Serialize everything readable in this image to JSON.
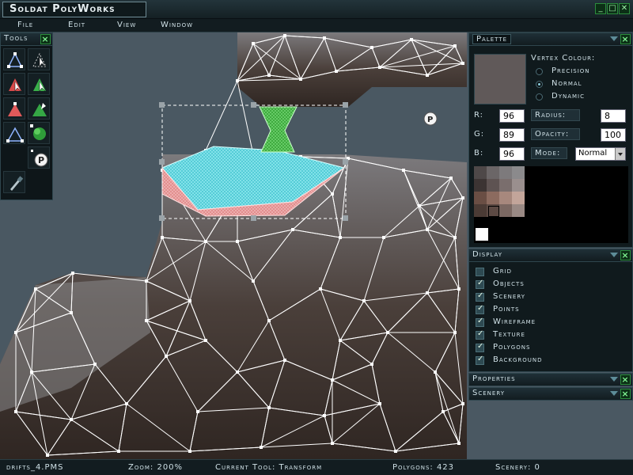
{
  "app": {
    "title": "Soldat PolyWorks"
  },
  "menu": {
    "file": "File",
    "edit": "Edit",
    "view": "View",
    "window": "Window"
  },
  "tools": {
    "title": "Tools"
  },
  "palette": {
    "title": "Palette",
    "vertex_colour_label": "Vertex Colour:",
    "options": [
      "Precision",
      "Normal",
      "Dynamic"
    ],
    "selected_option": "Normal",
    "r_label": "R:",
    "r_value": "96",
    "g_label": "G:",
    "g_value": "89",
    "b_label": "B:",
    "b_value": "96",
    "radius_label": "Radius:",
    "radius_value": "8",
    "opacity_label": "Opacity:",
    "opacity_value": "100",
    "mode_label": "Mode:",
    "mode_value": "Normal",
    "swatch_color": "#605959"
  },
  "display": {
    "title": "Display",
    "items": [
      {
        "label": "Grid",
        "checked": false
      },
      {
        "label": "Objects",
        "checked": true
      },
      {
        "label": "Scenery",
        "checked": true
      },
      {
        "label": "Points",
        "checked": true
      },
      {
        "label": "Wireframe",
        "checked": true
      },
      {
        "label": "Texture",
        "checked": true
      },
      {
        "label": "Polygons",
        "checked": true
      },
      {
        "label": "Background",
        "checked": true
      }
    ]
  },
  "properties": {
    "title": "Properties"
  },
  "scenery": {
    "title": "Scenery"
  },
  "status": {
    "file": "drifts_4.PMS",
    "zoom": "Zoom: 200%",
    "tool": "Current Tool: Transform",
    "polygons": "Polygons: 423",
    "scenery": "Scenery: 0"
  },
  "colors": {
    "accent_green": "#2b8c3c",
    "panel_bg": "#101a1d"
  }
}
